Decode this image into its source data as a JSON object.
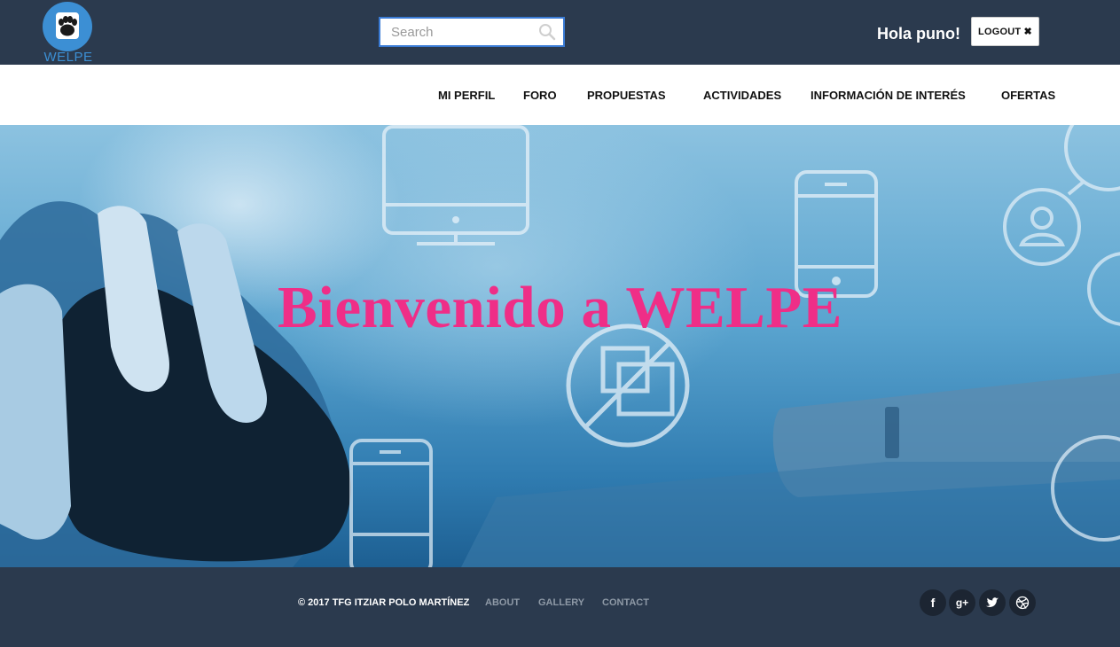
{
  "header": {
    "logo_text": "WELPE",
    "search_placeholder": "Search",
    "greeting": "Hola puno!",
    "logout_label": "LOGOUT ✖"
  },
  "nav": {
    "items": [
      {
        "label": "MI PERFIL"
      },
      {
        "label": "FORO"
      },
      {
        "label": "PROPUESTAS"
      },
      {
        "label": "ACTIVIDADES"
      },
      {
        "label": "INFORMACIÓN DE INTERÉS"
      },
      {
        "label": "OFERTAS"
      }
    ]
  },
  "hero": {
    "title": "Bienvenido a WELPE"
  },
  "footer": {
    "copyright": "© 2017 TFG ITZIAR POLO MARTÍNEZ",
    "links": [
      {
        "label": "ABOUT"
      },
      {
        "label": "GALLERY"
      },
      {
        "label": "CONTACT"
      }
    ],
    "social": [
      {
        "icon": "facebook-icon",
        "glyph": "f"
      },
      {
        "icon": "google-plus-icon",
        "glyph": "g+"
      },
      {
        "icon": "twitter-icon",
        "glyph": ""
      },
      {
        "icon": "dribbble-icon",
        "glyph": ""
      }
    ]
  },
  "colors": {
    "header_bg": "#2b3a4e",
    "brand_blue": "#3c8fd4",
    "hero_title": "#ef2e87",
    "footer_link": "#8e99a6"
  }
}
